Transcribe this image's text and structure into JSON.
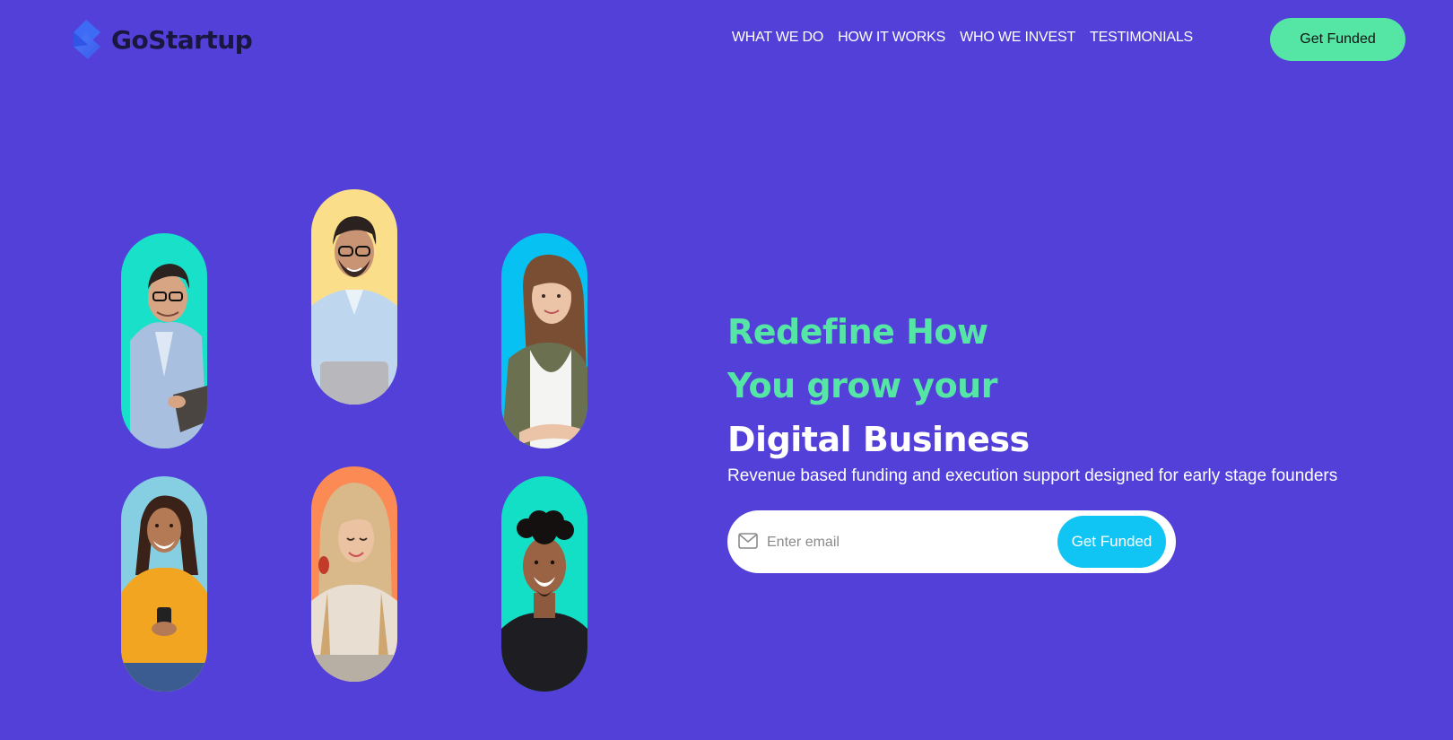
{
  "brand": {
    "name": "GoStartup"
  },
  "nav": {
    "items": [
      {
        "label": "WHAT WE DO"
      },
      {
        "label": "HOW IT WORKS"
      },
      {
        "label": "WHO WE INVEST"
      },
      {
        "label": "TESTIMONIALS"
      }
    ],
    "cta_label": "Get Funded"
  },
  "hero": {
    "line1": "Redefine How",
    "line2": "You grow your",
    "line3": "Digital Business",
    "subtitle": "Revenue based funding and execution support designed for early stage founders"
  },
  "email_form": {
    "placeholder": "Enter email",
    "value": "",
    "cta_label": "Get Funded",
    "icon": "mail-icon"
  },
  "portraits": [
    {
      "bg": "#19E0C8"
    },
    {
      "bg": "#FBDE8A"
    },
    {
      "bg": "#06C1F2"
    },
    {
      "bg": "#86CFE2"
    },
    {
      "bg": "#FB8A54"
    },
    {
      "bg": "#12DFC6"
    }
  ],
  "colors": {
    "page_bg": "#5340D8",
    "accent_green": "#55E6A5",
    "accent_cyan": "#10C4F4",
    "text_white": "#FFFFFF",
    "logo_dark": "#1B1640"
  }
}
